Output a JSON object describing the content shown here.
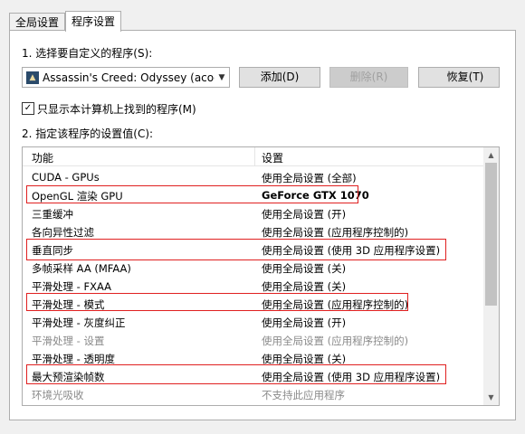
{
  "tabs": [
    {
      "label": "全局设置"
    },
    {
      "label": "程序设置"
    }
  ],
  "step1": {
    "label": "1. 选择要自定义的程序(S):"
  },
  "program_select": {
    "value": "Assassin's Creed: Odyssey (acod..."
  },
  "buttons": {
    "add": "添加(D)",
    "remove": "删除(R)",
    "restore": "恢复(T)"
  },
  "checkbox": {
    "label": "只显示本计算机上找到的程序(M)",
    "checked": true
  },
  "step2": {
    "label": "2. 指定该程序的设置值(C):"
  },
  "table": {
    "headers": {
      "feature": "功能",
      "setting": "设置"
    },
    "rows": [
      {
        "feature": "CUDA - GPUs",
        "setting": "使用全局设置 (全部)"
      },
      {
        "feature": "OpenGL 渲染 GPU",
        "setting": "GeForce GTX 1070"
      },
      {
        "feature": "三重缓冲",
        "setting": "使用全局设置 (开)"
      },
      {
        "feature": "各向异性过滤",
        "setting": "使用全局设置 (应用程序控制的)"
      },
      {
        "feature": "垂直同步",
        "setting": "使用全局设置 (使用 3D 应用程序设置)"
      },
      {
        "feature": "多帧采样 AA (MFAA)",
        "setting": "使用全局设置 (关)"
      },
      {
        "feature": "平滑处理 - FXAA",
        "setting": "使用全局设置 (关)"
      },
      {
        "feature": "平滑处理 - 模式",
        "setting": "使用全局设置 (应用程序控制的)"
      },
      {
        "feature": "平滑处理 - 灰度纠正",
        "setting": "使用全局设置 (开)"
      },
      {
        "feature": "平滑处理 - 设置",
        "setting": "使用全局设置 (应用程序控制的)"
      },
      {
        "feature": "平滑处理 - 透明度",
        "setting": "使用全局设置 (关)"
      },
      {
        "feature": "最大预渲染帧数",
        "setting": "使用全局设置 (使用 3D 应用程序设置)"
      },
      {
        "feature": "环境光吸收",
        "setting": "不支持此应用程序"
      }
    ]
  },
  "colors": {
    "highlight": "#e02020",
    "nvidia_green": "#76b900"
  }
}
